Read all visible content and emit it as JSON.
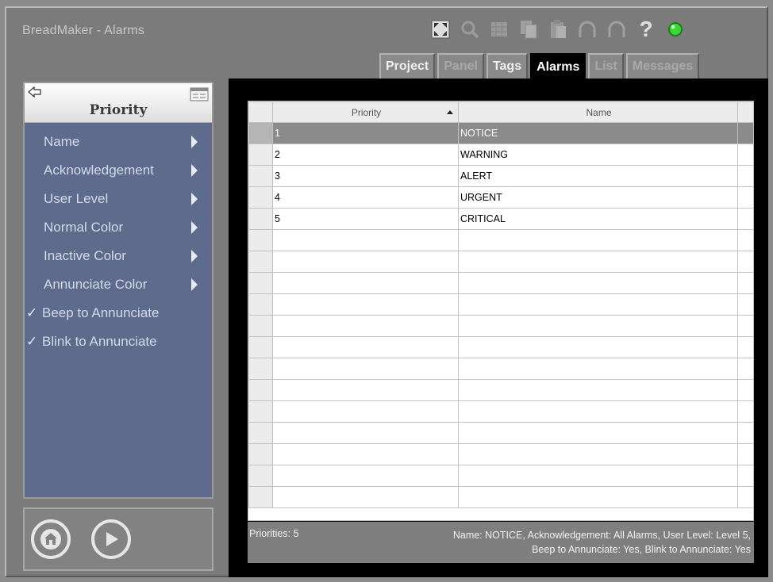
{
  "app": {
    "title": "BreadMaker - Alarms"
  },
  "toolbar": {
    "icons": [
      "fullscreen-icon",
      "search-icon",
      "grid-icon",
      "copy-icon",
      "paste-icon",
      "undo-icon",
      "redo-icon",
      "help-icon",
      "status-led-icon"
    ],
    "help_label": "?"
  },
  "tabs": [
    {
      "label": "Project",
      "state": "enabled"
    },
    {
      "label": "Panel",
      "state": "disabled"
    },
    {
      "label": "Tags",
      "state": "enabled"
    },
    {
      "label": "Alarms",
      "state": "active"
    },
    {
      "label": "List",
      "state": "disabled"
    },
    {
      "label": "Messages",
      "state": "disabled"
    }
  ],
  "sidebar": {
    "title": "Priority",
    "items": [
      {
        "label": "Name",
        "type": "submenu"
      },
      {
        "label": "Acknowledgement",
        "type": "submenu"
      },
      {
        "label": "User Level",
        "type": "submenu"
      },
      {
        "label": "Normal Color",
        "type": "submenu"
      },
      {
        "label": "Inactive Color",
        "type": "submenu"
      },
      {
        "label": "Annunciate Color",
        "type": "submenu"
      },
      {
        "label": "Beep to Annunciate",
        "type": "check",
        "checked": true
      },
      {
        "label": "Blink to Annunciate",
        "type": "check",
        "checked": true
      }
    ],
    "check_glyph": "✓"
  },
  "table": {
    "columns": [
      "Priority",
      "Name"
    ],
    "rows": [
      {
        "priority": "1",
        "name": "NOTICE",
        "selected": true
      },
      {
        "priority": "2",
        "name": "WARNING",
        "selected": false
      },
      {
        "priority": "3",
        "name": "ALERT",
        "selected": false
      },
      {
        "priority": "4",
        "name": "URGENT",
        "selected": false
      },
      {
        "priority": "5",
        "name": "CRITICAL",
        "selected": false
      }
    ]
  },
  "status": {
    "count": "Priorities: 5",
    "line1": "Name: NOTICE, Acknowledgement: All Alarms, User Level: Level 5,",
    "line2": "Beep to Annunciate: Yes, Blink to Annunciate: Yes"
  },
  "colors": {
    "sidebar_bg": "#5e6b8c",
    "selected_row": "#8b8b8b",
    "status_led": "#2ad12a"
  }
}
